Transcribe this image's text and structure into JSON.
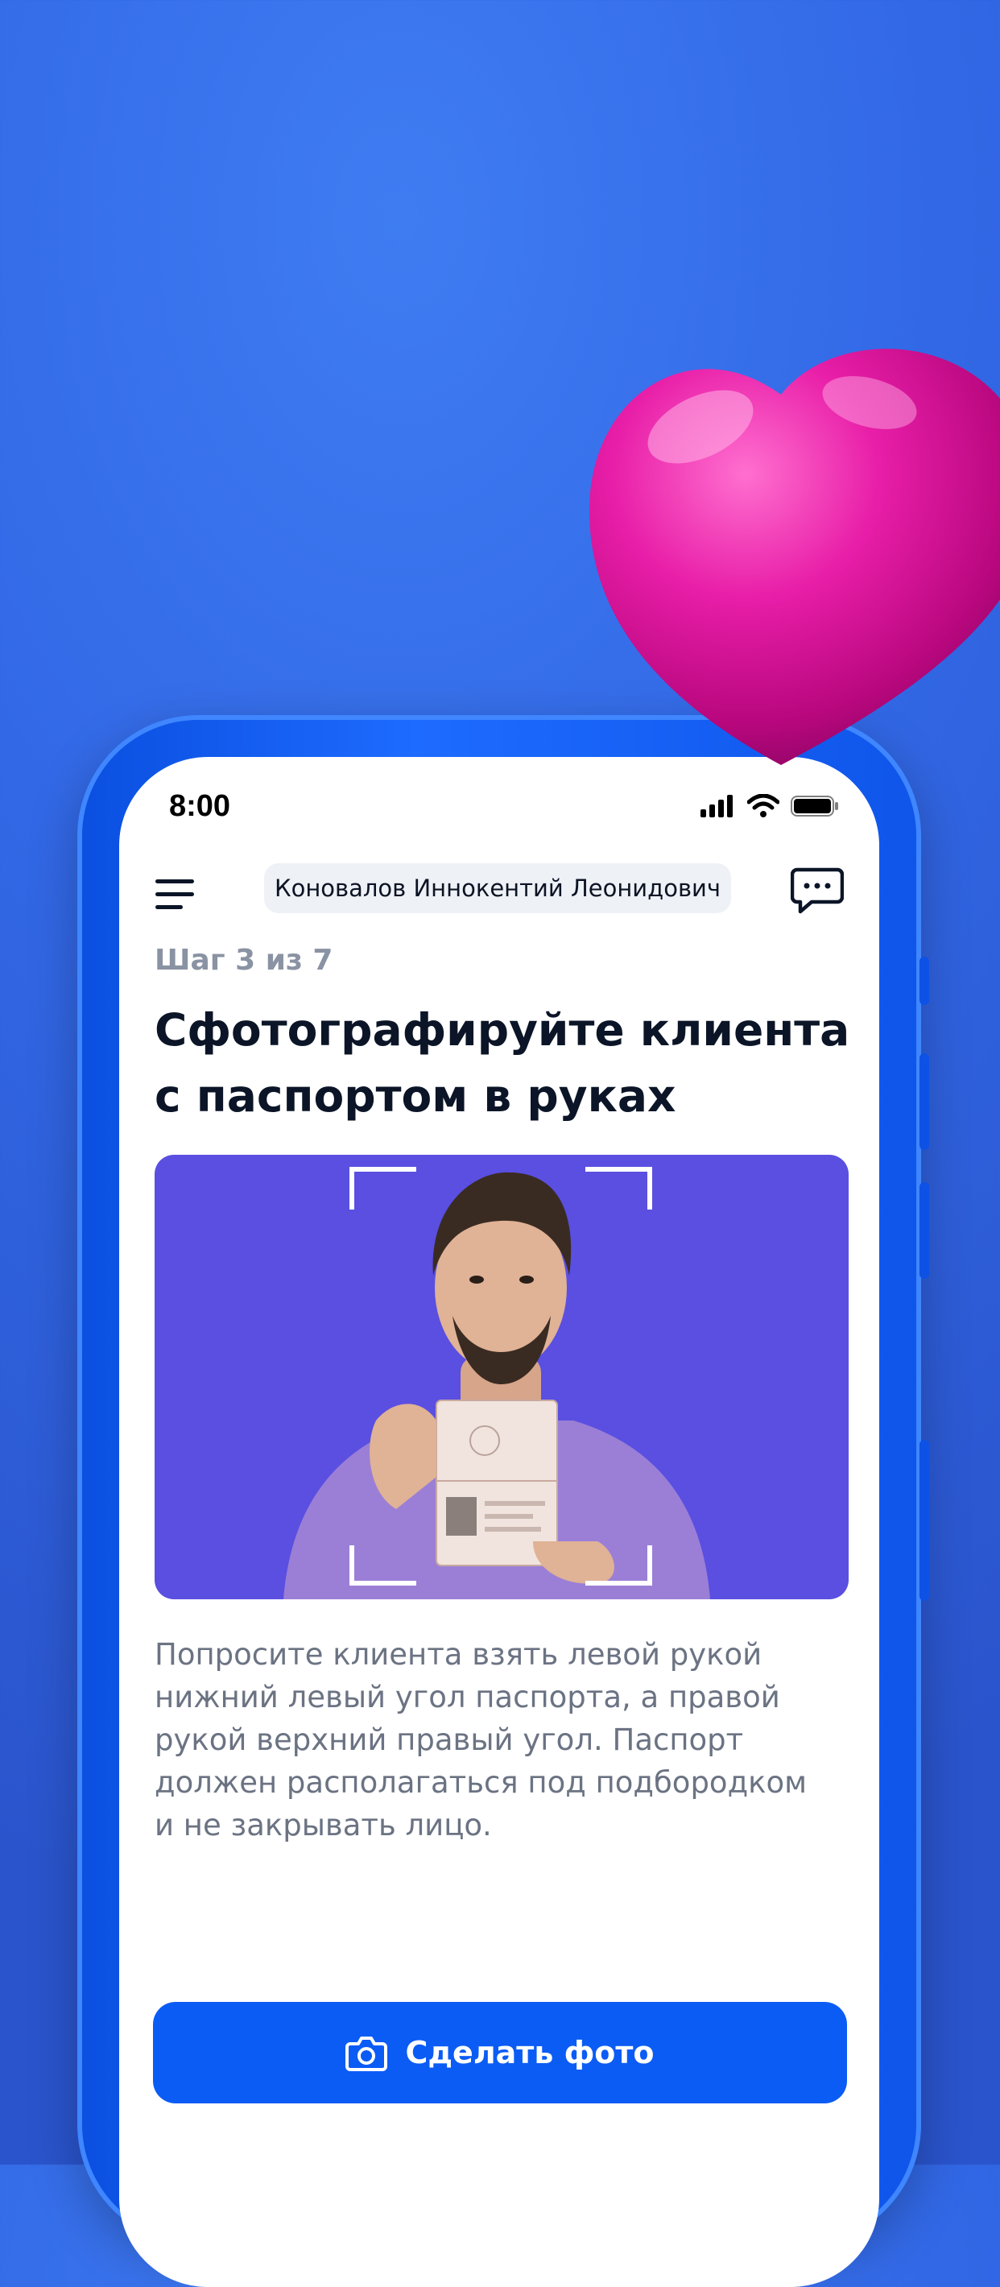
{
  "status_bar": {
    "time": "8:00",
    "icons": [
      "signal-icon",
      "wifi-icon",
      "battery-icon"
    ]
  },
  "header": {
    "menu_icon": "menu-icon",
    "client_name": "Коновалов Иннокентий Леонидович",
    "chat_icon": "chat-icon"
  },
  "step": {
    "label": "Шаг 3 из 7"
  },
  "title": {
    "line1": "Сфотографируйте клиента",
    "line2": "с паспортом в руках"
  },
  "illustration": {
    "icon": "person-with-passport-photo",
    "background_color": "#5a4fe0"
  },
  "instructions": {
    "line1": "Попросите клиента взять левой рукой",
    "line2": "нижний левый угол паспорта, а правой",
    "line3": "рукой верхний правый угол. Паспорт",
    "line4": "должен располагаться под подбородком",
    "line5": "и не закрывать лицо."
  },
  "action": {
    "label": "Сделать фото",
    "icon": "camera-icon"
  },
  "colors": {
    "background": "#3268e6",
    "phone_frame": "#1e6bff",
    "accent": "#0b5cf5",
    "heart": "#e0169a"
  }
}
